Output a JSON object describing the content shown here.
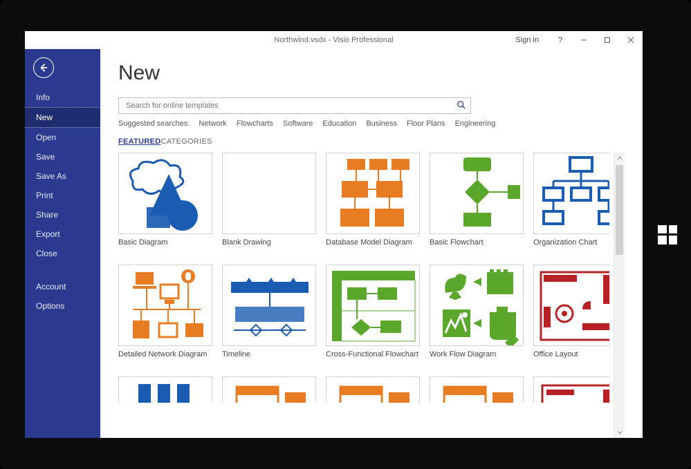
{
  "window": {
    "title": "Northwind.vsdx - Visio Professional",
    "signin": "Sign in",
    "help_symbol": "?"
  },
  "sidebar": {
    "items": [
      "Info",
      "New",
      "Open",
      "Save",
      "Save As",
      "Print",
      "Share",
      "Export",
      "Close"
    ],
    "selected_index": 1,
    "lower_items": [
      "Account",
      "Options"
    ]
  },
  "page": {
    "title": "New",
    "search": {
      "placeholder": "Search for online templates"
    },
    "suggested_label": "Suggested searches:",
    "suggested": [
      "Network",
      "Flowcharts",
      "Software",
      "Education",
      "Business",
      "Floor Plans",
      "Engineering"
    ],
    "tabs": [
      "FEATURED",
      "CATEGORIES"
    ],
    "active_tab_index": 0
  },
  "templates": [
    {
      "name": "Basic Diagram",
      "icon": "basic-diagram",
      "color": "#1b5cb3"
    },
    {
      "name": "Blank Drawing",
      "icon": "blank",
      "color": "#ffffff"
    },
    {
      "name": "Database Model Diagram",
      "icon": "database",
      "color": "#e77c22"
    },
    {
      "name": "Basic Flowchart",
      "icon": "flowchart",
      "color": "#5aa72c"
    },
    {
      "name": "Organization Chart",
      "icon": "orgchart",
      "color": "#1b5cb3"
    },
    {
      "name": "Detailed Network Diagram",
      "icon": "network",
      "color": "#e77c22"
    },
    {
      "name": "Timeline",
      "icon": "timeline",
      "color": "#1b5cb3"
    },
    {
      "name": "Cross-Functional Flowchart",
      "icon": "crossfunc",
      "color": "#5aa72c"
    },
    {
      "name": "Work Flow Diagram",
      "icon": "workflow",
      "color": "#5aa72c"
    },
    {
      "name": "Office Layout",
      "icon": "office",
      "color": "#b72025"
    },
    {
      "name": "",
      "icon": "partial-blue",
      "color": "#1b5cb3"
    },
    {
      "name": "",
      "icon": "partial-orange",
      "color": "#e77c22"
    },
    {
      "name": "",
      "icon": "partial-orange",
      "color": "#e77c22"
    },
    {
      "name": "",
      "icon": "partial-orange",
      "color": "#e77c22"
    },
    {
      "name": "",
      "icon": "partial-red",
      "color": "#b72025"
    }
  ]
}
